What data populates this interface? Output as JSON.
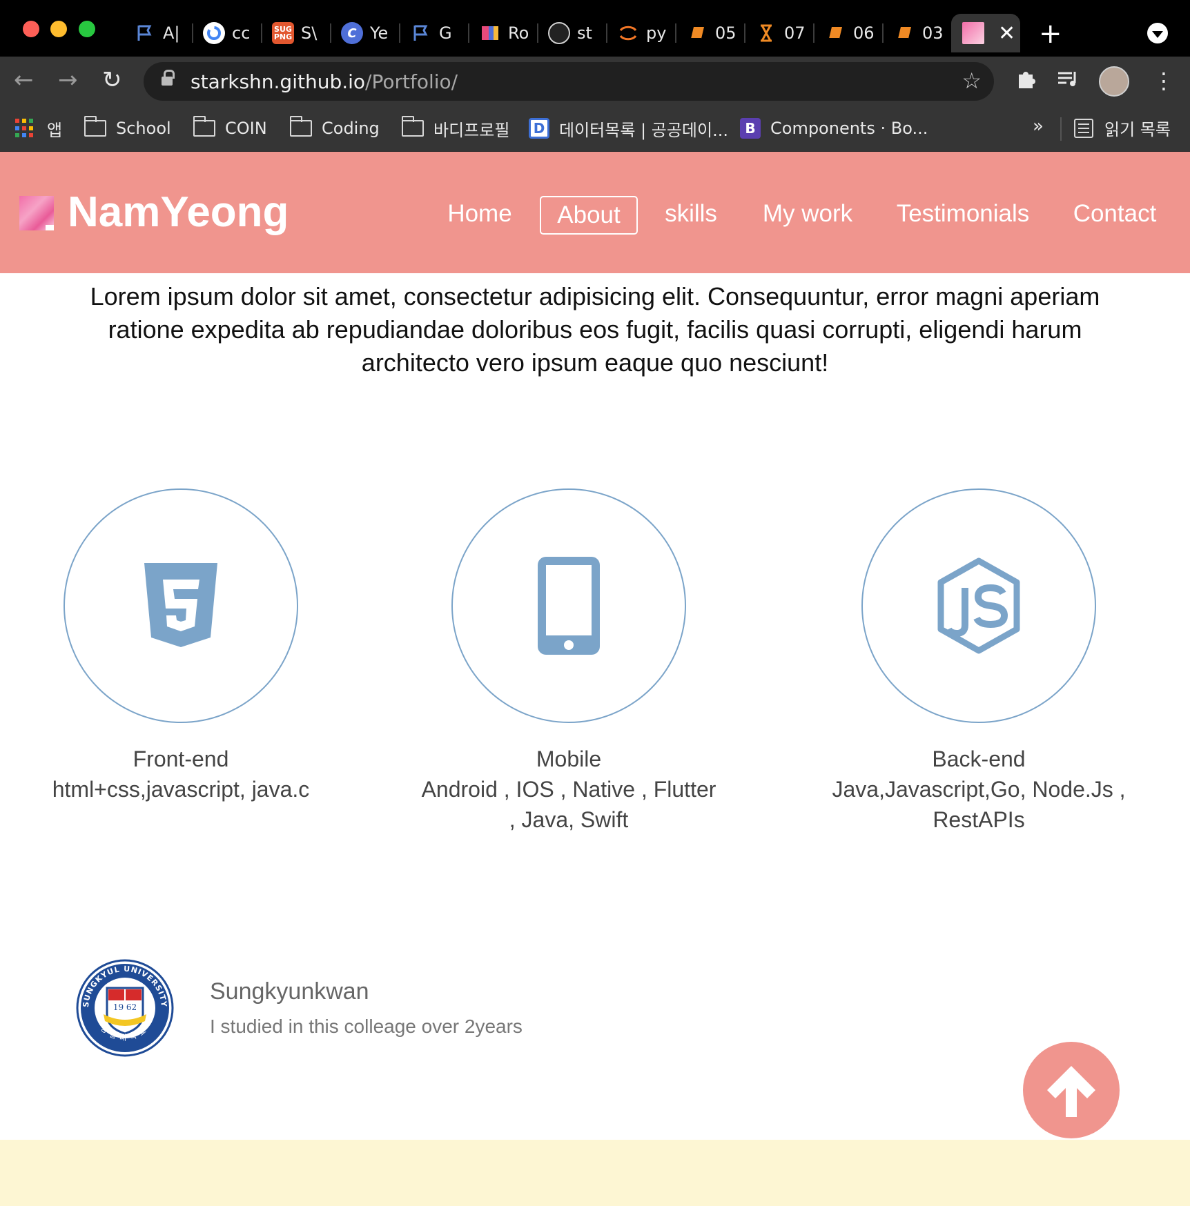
{
  "browser": {
    "tabs": [
      {
        "title": "A|",
        "favicon": "flag-icon",
        "color": "#5a86d6"
      },
      {
        "title": "cc",
        "favicon": "google-icon",
        "color": "#ffffff"
      },
      {
        "title": "S\\",
        "favicon": "sug-png-icon",
        "color": "#e2572f"
      },
      {
        "title": "Ye",
        "favicon": "c-circle-icon",
        "color": "#4f6fd8"
      },
      {
        "title": "G",
        "favicon": "flag-icon",
        "color": "#5a86d6"
      },
      {
        "title": "Ro",
        "favicon": "color-blocks-icon",
        "color": "#e64a7b"
      },
      {
        "title": "st",
        "favicon": "github-icon",
        "color": "#d0d0d0"
      },
      {
        "title": "py",
        "favicon": "jupyter-icon",
        "color": "#f37726"
      },
      {
        "title": "05",
        "favicon": "book-icon",
        "color": "#f08a24"
      },
      {
        "title": "07",
        "favicon": "hourglass-icon",
        "color": "#f08a24"
      },
      {
        "title": "06",
        "favicon": "book-icon",
        "color": "#f08a24"
      },
      {
        "title": "03",
        "favicon": "book-icon",
        "color": "#f08a24"
      }
    ],
    "active_tab": {
      "favicon": "portfolio-logo-icon",
      "close": "✕"
    },
    "new_tab": "+",
    "url_host": "starkshn.github.io",
    "url_path": "/Portfolio/",
    "bookmarks": [
      {
        "label": "앱",
        "kind": "apps"
      },
      {
        "label": "School",
        "kind": "folder"
      },
      {
        "label": "COIN",
        "kind": "folder"
      },
      {
        "label": "Coding",
        "kind": "folder"
      },
      {
        "label": "바디프로필",
        "kind": "folder"
      },
      {
        "label": "데이터목록 | 공공데이...",
        "kind": "site",
        "badge": "D"
      },
      {
        "label": "Components · Bo...",
        "kind": "site",
        "badge": "B"
      }
    ],
    "bookmarks_more": "»",
    "reading_list": "읽기 목록"
  },
  "site": {
    "brand": "NamYeong",
    "nav": [
      "Home",
      "About",
      "skills",
      "My work",
      "Testimonials",
      "Contact"
    ],
    "active_nav": "About",
    "colors": {
      "header": "#f0958e",
      "icon": "#7ba4c9",
      "footer": "#fdf6d3"
    },
    "intro": "Lorem ipsum dolor sit amet, consectetur adipisicing elit. Consequuntur, error magni aperiam ratione expedita ab repudiandae doloribus eos fugit, facilis quasi corrupti, eligendi harum architecto vero ipsum eaque quo nesciunt!",
    "skills": [
      {
        "icon": "html5-icon",
        "title": "Front-end",
        "desc": "html+css,javascript, java.c"
      },
      {
        "icon": "mobile-phone-icon",
        "title": "Mobile",
        "desc": "Android , IOS , Native , Flutter , Java, Swift"
      },
      {
        "icon": "nodejs-icon",
        "title": "Back-end",
        "desc": "Java,Javascript,Go, Node.Js , RestAPIs"
      }
    ],
    "education": {
      "seal_text": "SUNGKYUL UNIVERSITY",
      "seal_year": "19 62",
      "seal_korean": "성결대학교",
      "title": "Sungkyunkwan",
      "desc": "I studied in this colleage over 2years"
    },
    "to_top": "arrow-up-icon"
  }
}
